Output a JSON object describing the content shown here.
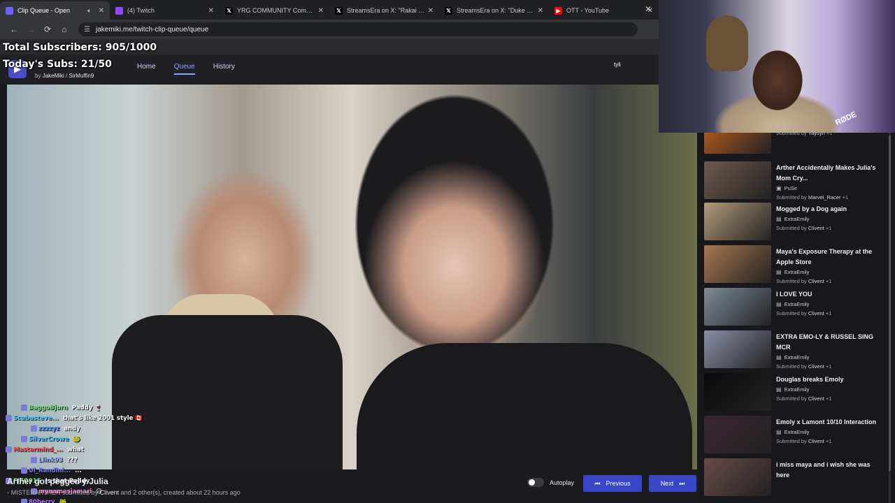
{
  "browser": {
    "tabs": [
      {
        "title": "Clip Queue - Open",
        "active": true,
        "favicon": "clip-queue-icon",
        "favicon_color": "#6c63ff"
      },
      {
        "title": "(4) Twitch",
        "active": false,
        "favicon": "twitch-icon",
        "favicon_color": "#9146ff"
      },
      {
        "title": "YRG COMMUNITY Community",
        "active": false,
        "favicon": "x-icon",
        "favicon_color": "#ffffff"
      },
      {
        "title": "StreamsEra on X: \"Rakai sound",
        "active": false,
        "favicon": "x-icon",
        "favicon_color": "#ffffff"
      },
      {
        "title": "StreamsEra on X: \"Duke Dennis",
        "active": false,
        "favicon": "x-icon",
        "favicon_color": "#ffffff"
      },
      {
        "title": "OTT - YouTube",
        "active": false,
        "favicon": "youtube-icon",
        "favicon_color": "#ff0000"
      }
    ],
    "url": "jakemiki.me/twitch-clip-queue/queue"
  },
  "overlay": {
    "total_subs": "Total Subscribers: 905/1000",
    "today_subs": "Today's Subs: 21/50"
  },
  "site": {
    "by_label": "by",
    "author1": "JakeMiki",
    "separator": "/",
    "author2": "SirMuffin9",
    "nav": [
      {
        "label": "Home",
        "active": false
      },
      {
        "label": "Queue",
        "active": true
      },
      {
        "label": "History",
        "active": false
      }
    ],
    "user_label": "tyli",
    "accent": "#3a46c8"
  },
  "chat": [
    {
      "user": "BaggoBjurn",
      "user_color": "#7ee07e",
      "msg": "Paddy 🍷"
    },
    {
      "user": "Scubasteve...",
      "user_color": "#5ad1ff",
      "msg": "that's like 2001 style 🇨🇦"
    },
    {
      "user": "zzzzyz",
      "user_color": "#4b8dff",
      "msg": "andy"
    },
    {
      "user": "SilverCrowe",
      "user_color": "#4bc0ff",
      "msg": "🐸"
    },
    {
      "user": "Mastermind_...",
      "user_color": "#ff5a5a",
      "msg": "what"
    },
    {
      "user": "Llink93",
      "user_color": "#8aa8ff",
      "msg": "???"
    },
    {
      "user": "Ul_Randini...",
      "user_color": "#7a7aff",
      "msg": "..."
    },
    {
      "user": "FIFO915",
      "user_color": "#7ee07e",
      "msg": "Is that Paddy"
    },
    {
      "user": "mynamesjamari",
      "user_color": "#ff7ad9",
      "msg": "😐"
    },
    {
      "user": "80berry",
      "user_color": "#a87aff",
      "msg": "🐸"
    },
    {
      "user": "wigglesPNG",
      "user_color": "#ffffff",
      "msg": "what?"
    },
    {
      "user": "MISTERARTHER",
      "user_color": "#ff5a5a",
      "msg": ""
    }
  ],
  "current_clip": {
    "title": "Arther got pegged y Julia",
    "channel": "MISTERARTHER",
    "submitted_prefix": "submitted by",
    "submitter": "Clivent",
    "submitted_suffix": "and 2 other(s), created about 22 hours ago"
  },
  "controls": {
    "autoplay_label": "Autoplay",
    "autoplay_on": false,
    "previous_label": "Previous",
    "next_label": "Next"
  },
  "queue": [
    {
      "title": "",
      "channel": "",
      "submitter": "Yaysyn",
      "extra": "+1",
      "thumb_color": "#c4601c"
    },
    {
      "title": "Arther Accidentally Makes Julia's Mom Cry...",
      "channel": "PuSe",
      "channel_icon": "video-icon",
      "submitter": "Marvel_Racer",
      "extra": "+1",
      "thumb_color": "#6f5a4e"
    },
    {
      "title": "Mogged by a Dog again",
      "channel": "ExtraEmily",
      "channel_icon": "chat-icon",
      "submitter": "Clivent",
      "extra": "+1",
      "thumb_color": "#b59b7a"
    },
    {
      "title": "Maya's Exposure Therapy at the Apple Store",
      "channel": "ExtraEmily",
      "channel_icon": "chat-icon",
      "submitter": "Clivent",
      "extra": "+1",
      "thumb_color": "#a8774f"
    },
    {
      "title": "I LOVE YOU",
      "channel": "ExtraEmily",
      "channel_icon": "chat-icon",
      "submitter": "Clivent",
      "extra": "+1",
      "thumb_color": "#7e8c9a"
    },
    {
      "title": "EXTRA EMO-LY & RUSSEL SING MCR",
      "channel": "ExtraEmily",
      "channel_icon": "chat-icon",
      "submitter": "Clivent",
      "extra": "+1",
      "thumb_color": "#8b8fa8"
    },
    {
      "title": "Douglas breaks Emoly",
      "channel": "ExtraEmily",
      "channel_icon": "chat-icon",
      "submitter": "Clivent",
      "extra": "+1",
      "thumb_color": "#0a0a0c"
    },
    {
      "title": "Emoly x Lamont 10/10 Interaction",
      "channel": "ExtraEmily",
      "channel_icon": "chat-icon",
      "submitter": "Clivent",
      "extra": "+1",
      "thumb_color": "#3a2530"
    },
    {
      "title": "i miss maya and i wish she was here",
      "channel": "",
      "submitter": "",
      "extra": "",
      "thumb_color": "#6a4a4a"
    }
  ],
  "queue_labels": {
    "submitted_by": "Submitted by"
  },
  "webcam": {
    "mic_brand": "RØDE"
  }
}
